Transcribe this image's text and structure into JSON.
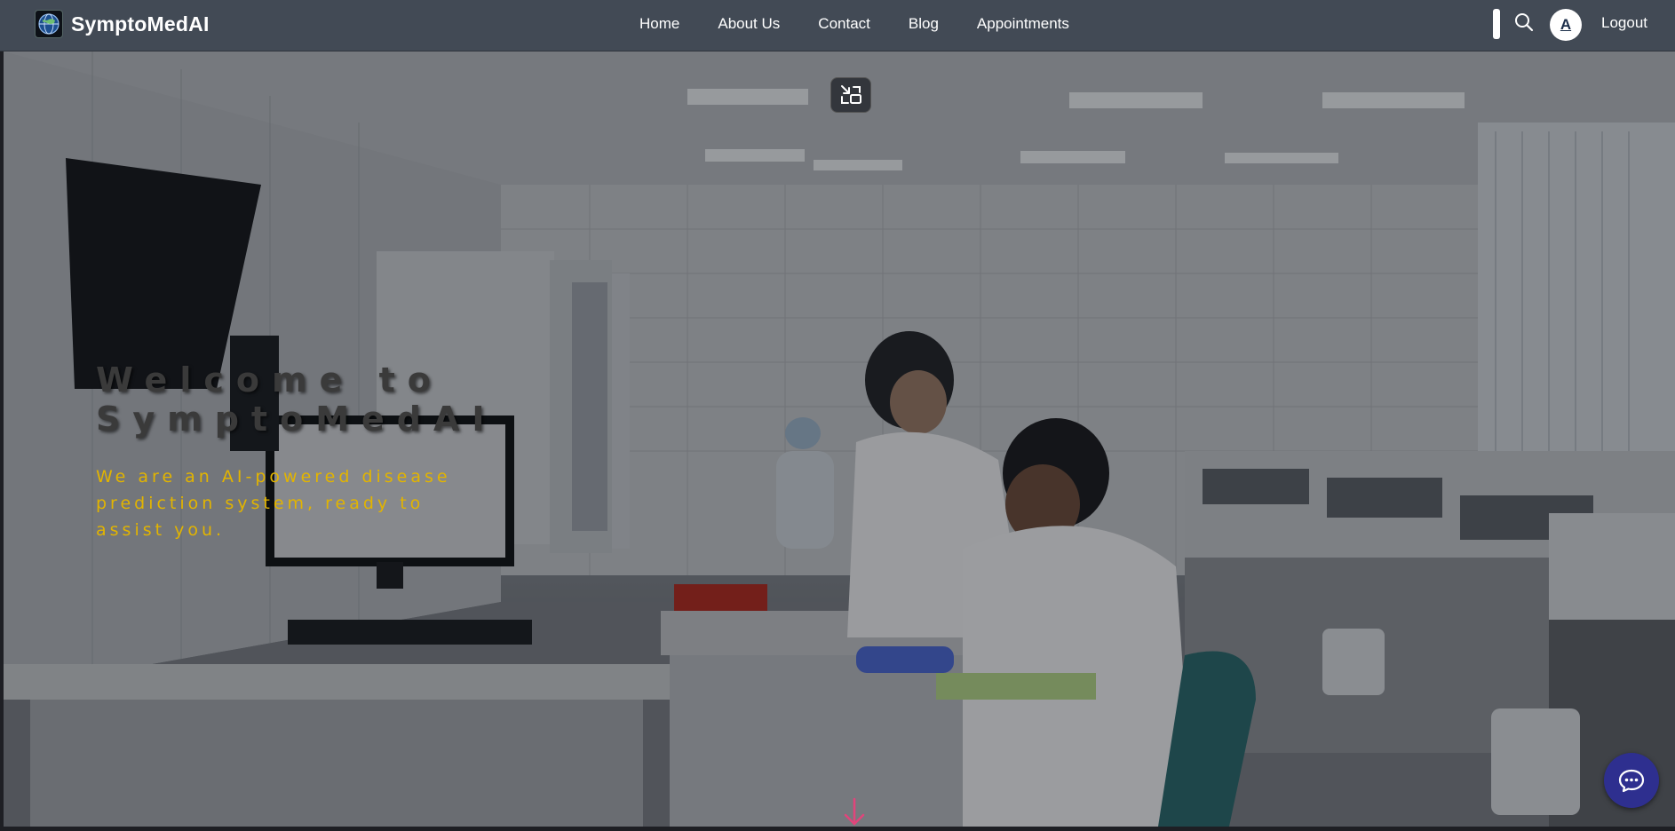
{
  "brand": {
    "name": "SymptoMedAI",
    "logo_icon": "globe-logo-icon"
  },
  "nav": {
    "links": [
      "Home",
      "About Us",
      "Contact",
      "Blog",
      "Appointments"
    ]
  },
  "user": {
    "avatar_initial": "A",
    "logout_label": "Logout"
  },
  "hero": {
    "title": "Welcome to SymptoMedAI",
    "subtitle": "We are an AI-powered disease prediction system, ready to assist you.",
    "background": "laboratory-photo",
    "exit_fullscreen_icon": "exit-fullscreen-icon",
    "scroll_icon": "arrow-down-icon"
  },
  "chat": {
    "icon": "chat-bubble-icon"
  },
  "colors": {
    "navbar_bg": "#424a55",
    "subtitle_text": "#e2b400",
    "chat_button": "#2e2f8f",
    "scroll_arrow": "#e0457b"
  }
}
